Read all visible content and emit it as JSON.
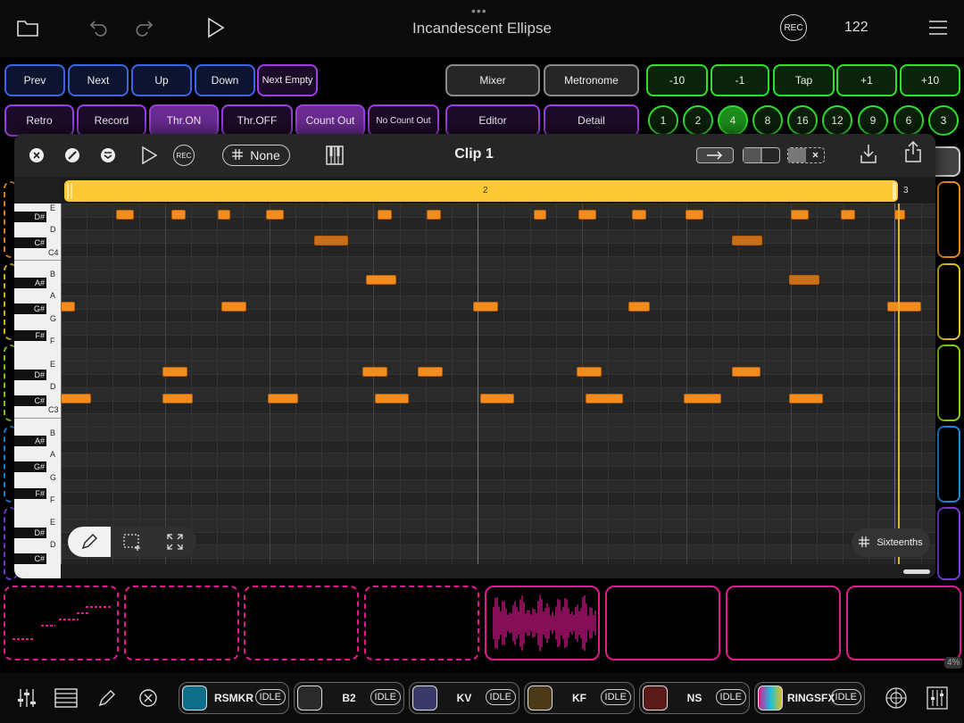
{
  "app": {
    "title": "Incandescent Ellipse",
    "bpm": "122",
    "rec_label": "REC"
  },
  "nav_buttons": [
    {
      "label": "Prev"
    },
    {
      "label": "Next"
    },
    {
      "label": "Up"
    },
    {
      "label": "Down"
    },
    {
      "label": "Next Empty"
    }
  ],
  "mode_buttons": [
    {
      "label": "Retro"
    },
    {
      "label": "Record"
    },
    {
      "label": "Thr.ON"
    },
    {
      "label": "Thr.OFF"
    },
    {
      "label": "Count Out"
    },
    {
      "label": "No Count Out"
    }
  ],
  "view_buttons": {
    "mixer": "Mixer",
    "metronome": "Metronome",
    "editor": "Editor",
    "detail": "Detail"
  },
  "tempo_buttons": [
    {
      "label": "-10"
    },
    {
      "label": "-1"
    },
    {
      "label": "Tap"
    },
    {
      "label": "+1"
    },
    {
      "label": "+10"
    }
  ],
  "length_buttons": [
    {
      "label": "1"
    },
    {
      "label": "2"
    },
    {
      "label": "4"
    },
    {
      "label": "8"
    },
    {
      "label": "16"
    },
    {
      "label": "12"
    },
    {
      "label": "9"
    },
    {
      "label": "6"
    },
    {
      "label": "3"
    }
  ],
  "selected_length": "4",
  "editor": {
    "clip_title": "Clip 1",
    "rec_label": "REC",
    "quantize_label": "None",
    "loop_label": "2",
    "loop_end_label": "3",
    "grid_label": "Sixteenths",
    "piano_keys": [
      {
        "label": "E"
      },
      {
        "label": "D#"
      },
      {
        "label": "D"
      },
      {
        "label": "C#"
      },
      {
        "label": "C4"
      },
      {
        "label": "B"
      },
      {
        "label": "A#"
      },
      {
        "label": "A"
      },
      {
        "label": "G#"
      },
      {
        "label": "G"
      },
      {
        "label": "F#"
      },
      {
        "label": "F"
      },
      {
        "label": "E"
      },
      {
        "label": "D#"
      },
      {
        "label": "D"
      },
      {
        "label": "C#"
      },
      {
        "label": "C3"
      },
      {
        "label": "B"
      },
      {
        "label": "A#"
      },
      {
        "label": "A"
      },
      {
        "label": "G#"
      },
      {
        "label": "G"
      },
      {
        "label": "F#"
      },
      {
        "label": "F"
      },
      {
        "label": "E"
      },
      {
        "label": "D#"
      },
      {
        "label": "D"
      },
      {
        "label": "C#"
      }
    ]
  },
  "plugins": [
    {
      "name": "RSMKR",
      "status": "IDLE"
    },
    {
      "name": "B2",
      "status": "IDLE"
    },
    {
      "name": "KV",
      "status": "IDLE"
    },
    {
      "name": "KF",
      "status": "IDLE"
    },
    {
      "name": "NS",
      "status": "IDLE"
    },
    {
      "name": "RINGSFX",
      "status": "IDLE"
    }
  ],
  "cpu_label": "4%",
  "colors": {
    "blue": "#3a66e6",
    "purple": "#9c3ee0",
    "green": "#2ee02e",
    "note": "#f28c1e",
    "loop": "#fcc935",
    "slot": "#e0198f"
  },
  "icons": [
    "folder-icon",
    "undo-icon",
    "redo-icon",
    "play-icon",
    "menu-icon",
    "close-icon",
    "pencil-icon",
    "grid-icon",
    "piano-icon",
    "import-icon",
    "share-icon",
    "mixer-icon",
    "list-icon",
    "tuner-icon",
    "meter-icon"
  ]
}
